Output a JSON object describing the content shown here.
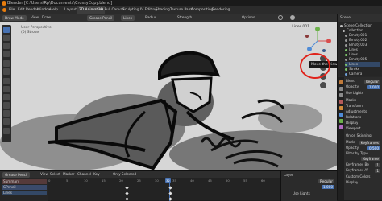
{
  "title": "Blender [C:\\Users\\Rp\\Documents\\CrossyCopy.blend]",
  "menu": [
    "File",
    "Edit",
    "Render",
    "Window",
    "Help"
  ],
  "workspaces": [
    "Layout",
    "2D Animation",
    "2D Full Canvas",
    "Sculpting",
    "UV Editing",
    "Shading",
    "Texture Paint",
    "Compositing",
    "Rendering"
  ],
  "active_workspace": "2D Animation",
  "header": {
    "mode": "Draw Mode",
    "items": [
      "View",
      "Draw"
    ],
    "brush": "Grease Pencil",
    "layer": "Lines",
    "radius_label": "Radius",
    "strength_label": "Strength",
    "options_label": "Options"
  },
  "viewport": {
    "perspective": "User Perspective",
    "collection": "(0) Stroke",
    "name_label": "Lines.001",
    "tooltip": "Move the view"
  },
  "outliner": {
    "search_label": "Scene",
    "items": [
      {
        "label": "Scene Collection",
        "color": "#bdbdbd"
      },
      {
        "label": "Collection",
        "color": "#bdbdbd"
      },
      {
        "label": "Empty.001",
        "color": "#9a9a9a"
      },
      {
        "label": "Empty.002",
        "color": "#9a9a9a"
      },
      {
        "label": "Empty.003",
        "color": "#9a9a9a"
      },
      {
        "label": "Lines",
        "color": "#7fc66b"
      },
      {
        "label": "Lines",
        "color": "#7fc66b"
      },
      {
        "label": "Empty.005",
        "color": "#9a9a9a"
      },
      {
        "label": "Lines",
        "color": "#7fc66b"
      },
      {
        "label": "Stroke",
        "color": "#7fc66b"
      },
      {
        "label": "Camera",
        "color": "#6fa0d8"
      }
    ]
  },
  "properties": {
    "blend_label": "Blend",
    "blend_value": "Regular",
    "opacity_label": "Opacity",
    "opacity_value": "1.000",
    "rows": [
      "Use Lights",
      "Masks",
      "Transform",
      "Adjustments",
      "Relations",
      "Display",
      "Viewport"
    ],
    "onion_label": "Onion Skinning",
    "mode_label": "Mode",
    "mode_value": "Keyframes",
    "opacity2_label": "Opacity",
    "opacity2_value": "0.500",
    "filter_label": "Filter by Type",
    "filter_value": "Keyframe",
    "before_label": "Keyframes Be",
    "before_value": "1",
    "after_label": "Keyframes Af",
    "after_value": "1",
    "custom_colors": "Custom Colors",
    "display": "Display"
  },
  "timeline": {
    "editor": "Grease Pencil",
    "menus": [
      "View",
      "Select",
      "Marker",
      "Channel",
      "Key"
    ],
    "only_selected": "Only Selected",
    "channels": [
      "Summary",
      "GPencil",
      "Lines"
    ],
    "frames": [
      "0",
      "5",
      "10",
      "15",
      "20",
      "25",
      "30",
      "35",
      "40",
      "45",
      "50",
      "55",
      "60"
    ],
    "current_frame": "32",
    "layer_title": "Layer",
    "layer_blend": "Regular",
    "layer_opacity": "1.000",
    "use_lights": "Use Lights"
  }
}
